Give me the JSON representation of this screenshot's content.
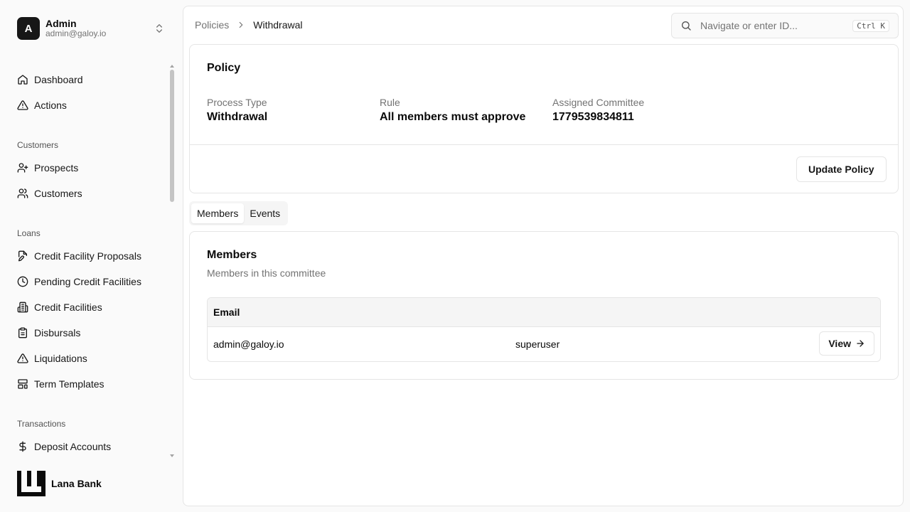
{
  "user": {
    "initial": "A",
    "name": "Admin",
    "email": "admin@galoy.io"
  },
  "nav": {
    "dashboard": "Dashboard",
    "actions": "Actions",
    "customers_section": "Customers",
    "prospects": "Prospects",
    "customers": "Customers",
    "loans_section": "Loans",
    "credit_facility_proposals": "Credit Facility Proposals",
    "pending_credit_facilities": "Pending Credit Facilities",
    "credit_facilities": "Credit Facilities",
    "disbursals": "Disbursals",
    "liquidations": "Liquidations",
    "term_templates": "Term Templates",
    "transactions_section": "Transactions",
    "deposit_accounts": "Deposit Accounts"
  },
  "brand": {
    "name": "Lana Bank"
  },
  "breadcrumb": {
    "parent": "Policies",
    "current": "Withdrawal"
  },
  "search": {
    "placeholder": "Navigate or enter ID...",
    "shortcut": "Ctrl K"
  },
  "policy": {
    "title": "Policy",
    "process_type_label": "Process Type",
    "process_type_value": "Withdrawal",
    "rule_label": "Rule",
    "rule_value": "All members must approve",
    "committee_label": "Assigned Committee",
    "committee_value": "1779539834811",
    "update_button": "Update Policy"
  },
  "tabs": {
    "members": "Members",
    "events": "Events"
  },
  "members": {
    "title": "Members",
    "subtitle": "Members in this committee",
    "header_email": "Email",
    "rows": [
      {
        "email": "admin@galoy.io",
        "role": "superuser",
        "action": "View"
      }
    ]
  }
}
